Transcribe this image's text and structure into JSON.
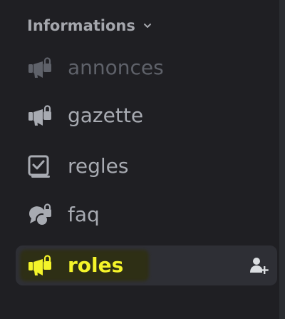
{
  "sidebar": {
    "category": {
      "label": "Informations",
      "icon": "chevron-down-icon"
    },
    "channels": [
      {
        "label": "annonces",
        "icon": "announcement-channel-icon",
        "color": "#5f626a",
        "state": "muted"
      },
      {
        "label": "gazette",
        "icon": "announcement-channel-icon",
        "color": "#a8abb2"
      },
      {
        "label": "regles",
        "icon": "rules-channel-icon",
        "color": "#a8abb2"
      },
      {
        "label": "faq",
        "icon": "forum-channel-icon",
        "color": "#a8abb2"
      },
      {
        "label": "roles",
        "icon": "announcement-channel-icon",
        "color": "#f4f42a",
        "state": "selected-highlighted",
        "action_icon": "create-invite-icon"
      }
    ]
  },
  "colors": {
    "background": "#1f1f23",
    "selected_bg": "#2e2f35",
    "highlight_text": "#f4f42a",
    "muted_text": "#5f626a",
    "normal_text": "#a8abb2"
  }
}
